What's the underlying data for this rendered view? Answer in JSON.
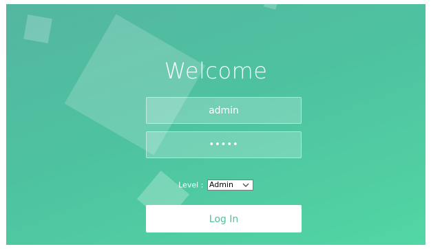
{
  "welcome": {
    "title": "Welcome"
  },
  "form": {
    "username_value": "admin",
    "password_value": "•••••",
    "level_label": "Level :",
    "level_selected": "Admin",
    "login_label": "Log In"
  },
  "colors": {
    "background_start": "#54b6a0",
    "background_end": "#52d6a4",
    "accent": "#4ec2a0",
    "text": "#ffffff"
  },
  "icons": {
    "select_caret": "chevron-down-icon"
  }
}
